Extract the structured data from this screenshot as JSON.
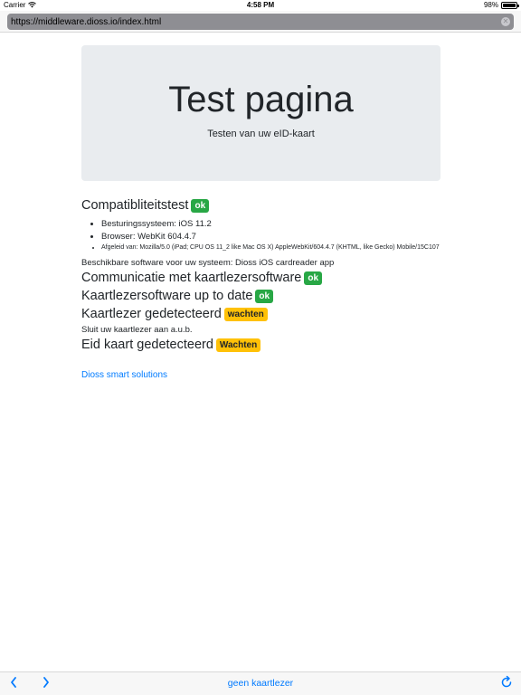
{
  "status_bar": {
    "carrier": "Carrier",
    "time": "4:58 PM",
    "battery": "98%",
    "battery_level": 0.98
  },
  "browser": {
    "url": "https://middleware.dioss.io/index.html"
  },
  "jumbotron": {
    "title": "Test pagina",
    "subtitle": "Testen van uw eID-kaart"
  },
  "compat": {
    "heading": "Compatibliteitstest",
    "badge": "ok",
    "items": [
      "Besturingssysteem: iOS 11.2",
      "Browser: WebKit 604.4.7",
      "Afgeleid van: Mozilla/5.0 (iPad; CPU OS 11_2 like Mac OS X) AppleWebKit/604.4.7 (KHTML, like Gecko) Mobile/15C107"
    ]
  },
  "software_text": "Beschikbare software voor uw systeem: Dioss iOS cardreader app",
  "communicatie": {
    "heading": "Communicatie met kaartlezersoftware",
    "badge": "ok"
  },
  "uptodate": {
    "heading": "Kaartlezersoftware up to date",
    "badge": "ok"
  },
  "kaartlezer": {
    "heading": "Kaartlezer gedetecteerd",
    "badge": "wachten"
  },
  "kaartlezer_hint": "Sluit uw kaartlezer aan a.u.b.",
  "eid": {
    "heading": "Eid kaart gedetecteerd",
    "badge": "Wachten"
  },
  "footer_link": "Dioss smart solutions",
  "toolbar": {
    "center": "geen kaartlezer"
  },
  "colors": {
    "ok": "#28a745",
    "waiting": "#ffc107",
    "link": "#007bff",
    "ios_blue": "#007aff"
  }
}
